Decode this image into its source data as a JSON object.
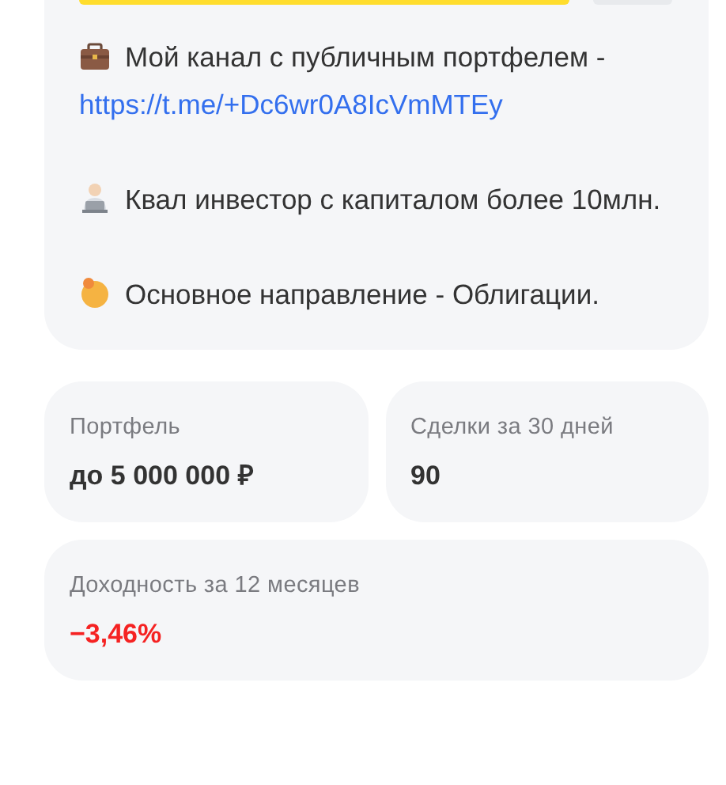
{
  "bio": [
    {
      "text": "Мой канал с публичным портфелем -",
      "link": "https://t.me/+Dc6wr0A8IcVmMTEy"
    },
    {
      "text": "Квал инвестор с капиталом более 10млн."
    },
    {
      "text": "Основное направление - Облигации."
    }
  ],
  "stats": [
    {
      "label": "Портфель",
      "value": "до 5 000 000 ₽",
      "kind": "plain"
    },
    {
      "label": "Сделки за 30 дней",
      "value": "90",
      "kind": "plain"
    },
    {
      "label": "Доходность за 12 месяцев",
      "value": "−3,46%",
      "kind": "loss"
    }
  ]
}
